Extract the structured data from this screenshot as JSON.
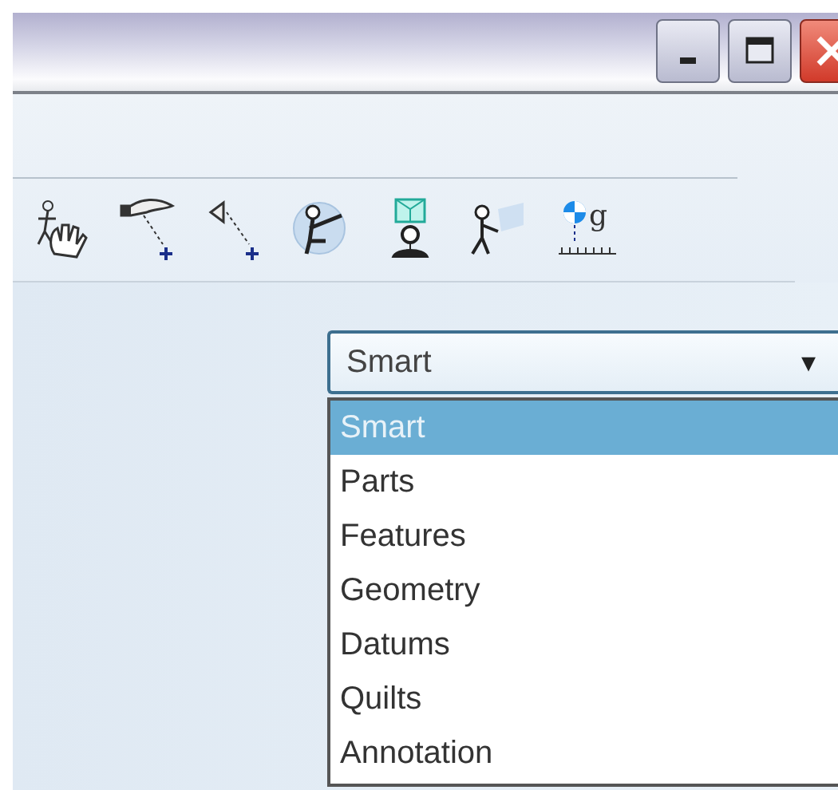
{
  "window": {
    "controls": [
      {
        "kind": "minimize"
      },
      {
        "kind": "maximize"
      },
      {
        "kind": "close"
      }
    ]
  },
  "toolbar": {
    "tools": [
      {
        "kind": "hand"
      },
      {
        "kind": "drag-pin"
      },
      {
        "kind": "cone-pin"
      },
      {
        "kind": "seated"
      },
      {
        "kind": "box-person"
      },
      {
        "kind": "walker"
      },
      {
        "kind": "mass",
        "label": "g"
      }
    ]
  },
  "filter": {
    "value": "Smart",
    "expanded": true,
    "caret": "▾",
    "options": [
      {
        "label": "Smart",
        "selected": true
      },
      {
        "label": "Parts",
        "selected": false
      },
      {
        "label": "Features",
        "selected": false
      },
      {
        "label": "Geometry",
        "selected": false
      },
      {
        "label": "Datums",
        "selected": false
      },
      {
        "label": "Quilts",
        "selected": false
      },
      {
        "label": "Annotation",
        "selected": false
      }
    ]
  }
}
